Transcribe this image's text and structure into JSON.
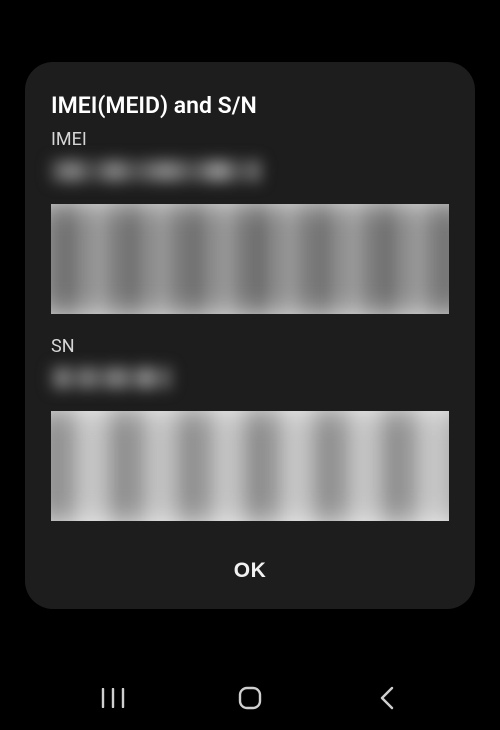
{
  "dialog": {
    "title": "IMEI(MEID) and S/N",
    "imei": {
      "label": "IMEI",
      "value": "REDACTED",
      "barcode": "REDACTED"
    },
    "sn": {
      "label": "SN",
      "value": "REDACTED",
      "barcode": "REDACTED"
    },
    "ok_label": "OK"
  },
  "navbar": {
    "recents_icon": "recents-icon",
    "home_icon": "home-icon",
    "back_icon": "back-icon"
  }
}
